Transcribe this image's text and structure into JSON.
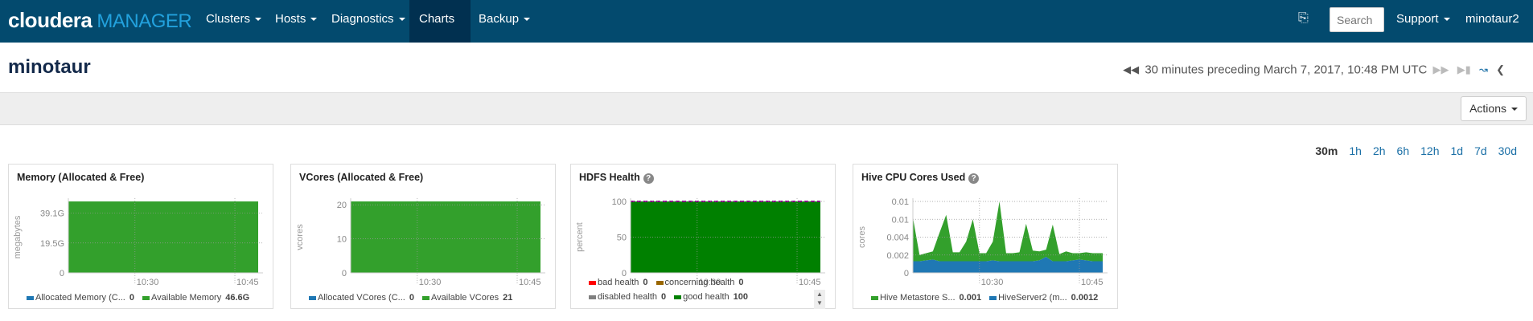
{
  "nav": {
    "logo_brand": "cloudera",
    "logo_product": "MANAGER",
    "items": [
      {
        "label": "Clusters"
      },
      {
        "label": "Hosts"
      },
      {
        "label": "Diagnostics"
      },
      {
        "label": "Charts",
        "active": true
      },
      {
        "label": "Backup"
      }
    ],
    "search_placeholder": "Search",
    "support": "Support",
    "user": "minotaur2",
    "icon": "running-commands-icon",
    "accent": "#034a6e"
  },
  "page": {
    "title": "minotaur",
    "time_range": "30 minutes preceding March 7, 2017, 10:48 PM UTC",
    "actions": "Actions"
  },
  "ranges": [
    {
      "label": "30m",
      "selected": true
    },
    {
      "label": "1h"
    },
    {
      "label": "2h"
    },
    {
      "label": "6h"
    },
    {
      "label": "12h"
    },
    {
      "label": "1d"
    },
    {
      "label": "7d"
    },
    {
      "label": "30d"
    }
  ],
  "chart_data": [
    {
      "type": "area",
      "title": "Memory (Allocated & Free)",
      "ylabel": "megabytes",
      "ylim": [
        0,
        46.6
      ],
      "yticks": [
        {
          "v": 0,
          "label": "0"
        },
        {
          "v": 19.5,
          "label": "19.5G"
        },
        {
          "v": 39.1,
          "label": "39.1G"
        }
      ],
      "xticks": [
        "10:30",
        "10:45"
      ],
      "x": [
        "10:20",
        "10:48"
      ],
      "series": [
        {
          "name": "Allocated Memory (C...",
          "values": [
            0,
            0
          ],
          "color": "#1f78b4",
          "legend_value": "0"
        },
        {
          "name": "Available Memory",
          "values": [
            46.6,
            46.6
          ],
          "color": "#33a02c",
          "legend_value": "46.6G"
        }
      ]
    },
    {
      "type": "area",
      "title": "VCores (Allocated & Free)",
      "ylabel": "vcores",
      "ylim": [
        0,
        21
      ],
      "yticks": [
        {
          "v": 0,
          "label": "0"
        },
        {
          "v": 10,
          "label": "10"
        },
        {
          "v": 20,
          "label": "20"
        }
      ],
      "xticks": [
        "10:30",
        "10:45"
      ],
      "x": [
        "10:20",
        "10:48"
      ],
      "series": [
        {
          "name": "Allocated VCores (C...",
          "values": [
            0,
            0
          ],
          "color": "#1f78b4",
          "legend_value": "0"
        },
        {
          "name": "Available VCores",
          "values": [
            21,
            21
          ],
          "color": "#33a02c",
          "legend_value": "21"
        }
      ]
    },
    {
      "type": "area",
      "title": "HDFS Health",
      "help": true,
      "ylabel": "percent",
      "ylim": [
        0,
        100
      ],
      "yticks": [
        {
          "v": 0,
          "label": "0"
        },
        {
          "v": 50,
          "label": "50"
        },
        {
          "v": 100,
          "label": "100"
        }
      ],
      "xticks": [
        "10:30",
        "10:45"
      ],
      "x": [
        "10:20",
        "10:48"
      ],
      "series": [
        {
          "name": "bad health",
          "values": [
            0,
            0
          ],
          "color": "#ff0000",
          "legend_value": "0"
        },
        {
          "name": "concerning health",
          "values": [
            0,
            0
          ],
          "color": "#996600",
          "legend_value": "0"
        },
        {
          "name": "disabled health",
          "values": [
            0,
            0
          ],
          "color": "#808080",
          "legend_value": "0"
        },
        {
          "name": "good health",
          "values": [
            100,
            100
          ],
          "color": "#008000",
          "legend_value": "100"
        }
      ]
    },
    {
      "type": "area",
      "stacked": true,
      "title": "Hive CPU Cores Used",
      "help": true,
      "ylabel": "cores",
      "ylim": [
        0,
        0.008
      ],
      "yticks": [
        {
          "v": 0,
          "label": "0"
        },
        {
          "v": 0.002,
          "label": "0.002"
        },
        {
          "v": 0.004,
          "label": "0.004"
        },
        {
          "v": 0.006,
          "label": "0.01"
        },
        {
          "v": 0.008,
          "label": "0.01"
        }
      ],
      "xticks": [
        "10:30",
        "10:45"
      ],
      "x": [
        "10:20",
        "10:21",
        "10:22",
        "10:23",
        "10:24",
        "10:25",
        "10:26",
        "10:27",
        "10:28",
        "10:29",
        "10:30",
        "10:31",
        "10:32",
        "10:33",
        "10:34",
        "10:35",
        "10:36",
        "10:37",
        "10:38",
        "10:39",
        "10:40",
        "10:41",
        "10:42",
        "10:43",
        "10:44",
        "10:45",
        "10:46",
        "10:47",
        "10:48"
      ],
      "series": [
        {
          "name": "HiveServer2 (m...",
          "color": "#1f78b4",
          "legend_value": "0.0012",
          "values": [
            0.0013,
            0.0013,
            0.0014,
            0.0015,
            0.0013,
            0.0013,
            0.0013,
            0.0013,
            0.0013,
            0.0013,
            0.0013,
            0.0013,
            0.0014,
            0.0013,
            0.0013,
            0.0013,
            0.0013,
            0.0013,
            0.0013,
            0.0014,
            0.0018,
            0.0013,
            0.0013,
            0.0013,
            0.0014,
            0.0015,
            0.0014,
            0.0013,
            0.0013
          ]
        },
        {
          "name": "Hive Metastore S...",
          "color": "#33a02c",
          "legend_value": "0.001",
          "values": [
            0.0049,
            0.0007,
            0.0008,
            0.0009,
            0.0032,
            0.0052,
            0.001,
            0.001,
            0.0022,
            0.0047,
            0.0009,
            0.0009,
            0.0021,
            0.0067,
            0.0009,
            0.0009,
            0.001,
            0.0042,
            0.0012,
            0.001,
            0.0008,
            0.0041,
            0.0008,
            0.0011,
            0.0008,
            0.0007,
            0.0009,
            0.0009,
            0.0009
          ]
        }
      ],
      "legend_order": [
        1,
        0
      ]
    }
  ]
}
